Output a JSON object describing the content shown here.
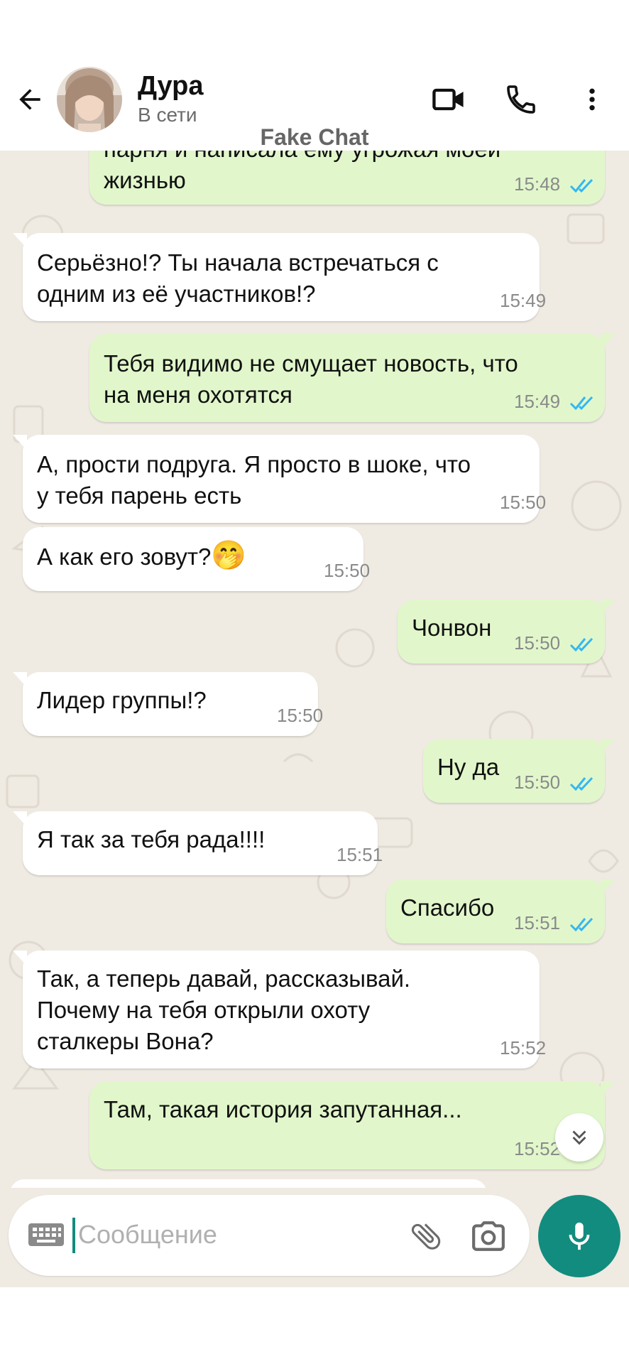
{
  "header": {
    "contact_name": "Дура",
    "status": "В сети",
    "icons": [
      "back-arrow-icon",
      "video-call-icon",
      "phone-icon",
      "more-vert-icon"
    ]
  },
  "watermark": "Fake Chat",
  "colors": {
    "chat_background": "#efeae2",
    "outgoing_bubble": "#e1f7cb",
    "incoming_bubble": "#ffffff",
    "read_ticks": "#34b7f1",
    "accent": "#128c7e"
  },
  "messages": [
    {
      "direction": "out",
      "text": "парня и написала ему угрожая моей\nжизнью",
      "time": "15:48",
      "read": true
    },
    {
      "direction": "in",
      "text": "Серьёзно!? Ты начала встречаться с\nодним из её участников!?",
      "time": "15:49"
    },
    {
      "direction": "out",
      "text": "Тебя видимо не смущает новость, что\nна меня охотятся",
      "time": "15:49",
      "read": true
    },
    {
      "direction": "in",
      "text": "А, прости подруга. Я просто в шоке, что\nу тебя парень есть",
      "time": "15:50"
    },
    {
      "direction": "in",
      "text": "А как его зовут?",
      "emoji": "🤭",
      "time": "15:50"
    },
    {
      "direction": "out",
      "text": "Чонвон",
      "time": "15:50",
      "read": true
    },
    {
      "direction": "in",
      "text": "Лидер группы!?",
      "time": "15:50"
    },
    {
      "direction": "out",
      "text": "Ну да",
      "time": "15:50",
      "read": true
    },
    {
      "direction": "in",
      "text": "Я так за тебя рада!!!!",
      "time": "15:51"
    },
    {
      "direction": "out",
      "text": "Спасибо",
      "time": "15:51",
      "read": true
    },
    {
      "direction": "in",
      "text": "Так, а теперь давай, рассказывай.\nПочему на тебя открыли охоту\nсталкеры Вона?",
      "time": "15:52"
    },
    {
      "direction": "out",
      "text": "Там, такая история запутанная...",
      "time": "15:52",
      "read": true
    }
  ],
  "input": {
    "placeholder": "Сообщение",
    "value": "",
    "icons": [
      "keyboard-icon",
      "attach-icon",
      "camera-icon",
      "mic-icon"
    ]
  }
}
